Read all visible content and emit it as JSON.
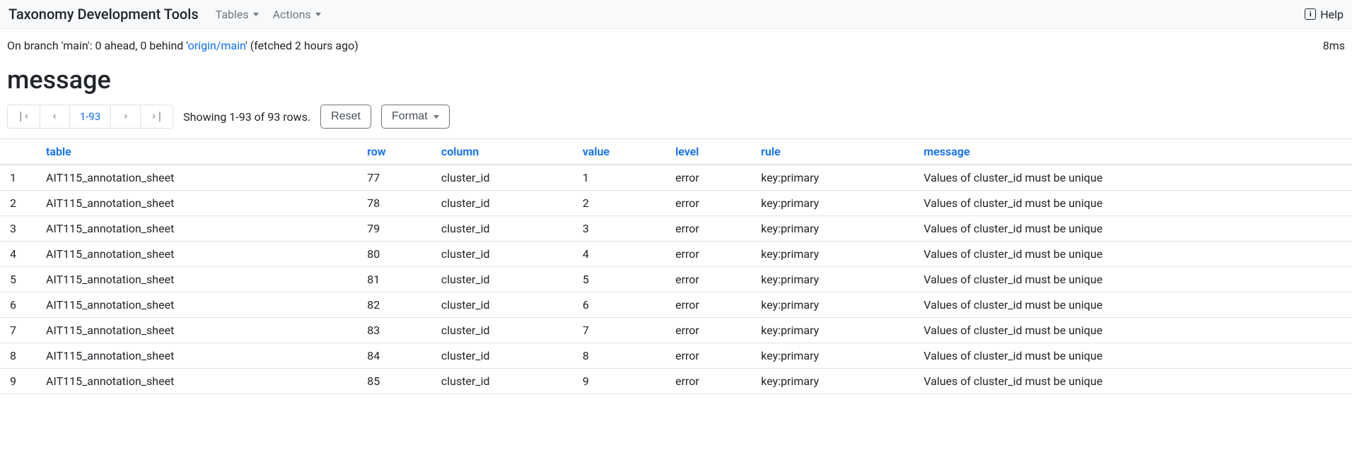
{
  "navbar": {
    "brand": "Taxonomy Development Tools",
    "menus": {
      "tables": "Tables",
      "actions": "Actions"
    },
    "help": "Help"
  },
  "status": {
    "prefix": "On branch 'main': 0 ahead, 0 behind '",
    "branch_link": "origin/main",
    "suffix": "' (fetched 2 hours ago)",
    "timing": "8ms"
  },
  "page": {
    "title": "message",
    "pager": {
      "first": "|‹",
      "prev": "‹",
      "range": "1-93",
      "next": "›",
      "last": "›|"
    },
    "showing": "Showing 1-93 of 93 rows.",
    "reset": "Reset",
    "format": "Format"
  },
  "columns": {
    "table": "table",
    "row": "row",
    "column": "column",
    "value": "value",
    "level": "level",
    "rule": "rule",
    "message": "message"
  },
  "rows": [
    {
      "idx": "1",
      "table": "AIT115_annotation_sheet",
      "row": "77",
      "column": "cluster_id",
      "value": "1",
      "level": "error",
      "rule": "key:primary",
      "message": "Values of cluster_id must be unique"
    },
    {
      "idx": "2",
      "table": "AIT115_annotation_sheet",
      "row": "78",
      "column": "cluster_id",
      "value": "2",
      "level": "error",
      "rule": "key:primary",
      "message": "Values of cluster_id must be unique"
    },
    {
      "idx": "3",
      "table": "AIT115_annotation_sheet",
      "row": "79",
      "column": "cluster_id",
      "value": "3",
      "level": "error",
      "rule": "key:primary",
      "message": "Values of cluster_id must be unique"
    },
    {
      "idx": "4",
      "table": "AIT115_annotation_sheet",
      "row": "80",
      "column": "cluster_id",
      "value": "4",
      "level": "error",
      "rule": "key:primary",
      "message": "Values of cluster_id must be unique"
    },
    {
      "idx": "5",
      "table": "AIT115_annotation_sheet",
      "row": "81",
      "column": "cluster_id",
      "value": "5",
      "level": "error",
      "rule": "key:primary",
      "message": "Values of cluster_id must be unique"
    },
    {
      "idx": "6",
      "table": "AIT115_annotation_sheet",
      "row": "82",
      "column": "cluster_id",
      "value": "6",
      "level": "error",
      "rule": "key:primary",
      "message": "Values of cluster_id must be unique"
    },
    {
      "idx": "7",
      "table": "AIT115_annotation_sheet",
      "row": "83",
      "column": "cluster_id",
      "value": "7",
      "level": "error",
      "rule": "key:primary",
      "message": "Values of cluster_id must be unique"
    },
    {
      "idx": "8",
      "table": "AIT115_annotation_sheet",
      "row": "84",
      "column": "cluster_id",
      "value": "8",
      "level": "error",
      "rule": "key:primary",
      "message": "Values of cluster_id must be unique"
    },
    {
      "idx": "9",
      "table": "AIT115_annotation_sheet",
      "row": "85",
      "column": "cluster_id",
      "value": "9",
      "level": "error",
      "rule": "key:primary",
      "message": "Values of cluster_id must be unique"
    }
  ]
}
